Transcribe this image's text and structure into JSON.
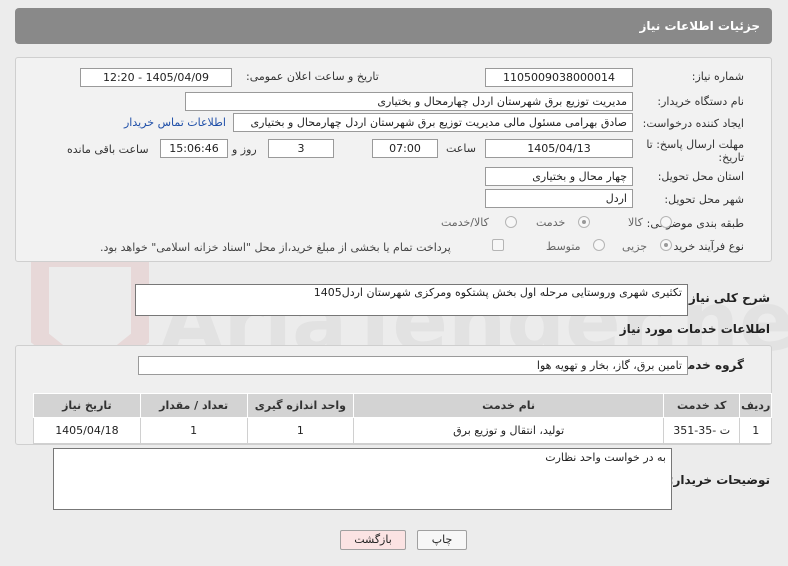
{
  "header": {
    "title": "جزئیات اطلاعات نیاز"
  },
  "form": {
    "need_number_label": "شماره نیاز:",
    "need_number": "1105009038000014",
    "announce_label": "تاریخ و ساعت اعلان عمومی:",
    "announce_value": "1405/04/09 - 12:20",
    "buyer_org_label": "نام دستگاه خریدار:",
    "buyer_org": "مدیریت توزیع برق شهرستان اردل چهارمحال و بختیاری",
    "creator_label": "ایجاد کننده درخواست:",
    "creator": "صادق بهرامی مسئول مالی مدیریت توزیع برق شهرستان اردل چهارمحال و بختیاری",
    "contact_link": "اطلاعات تماس خریدار",
    "deadline_label": "مهلت ارسال پاسخ: تا تاریخ:",
    "deadline_date": "1405/04/13",
    "time_label": "ساعت",
    "deadline_time": "07:00",
    "days_value": "3",
    "days_label": "روز و",
    "remaining_time": "15:06:46",
    "remaining_label": "ساعت باقی مانده",
    "province_label": "استان محل تحویل:",
    "province": "چهار محال و بختیاری",
    "city_label": "شهر محل تحویل:",
    "city": "اردل",
    "category_label": "طبقه بندی موضوعی:",
    "category_options": [
      "کالا",
      "خدمت",
      "کالا/خدمت"
    ],
    "process_label": "نوع فرآیند خرید :",
    "process_options": [
      "جزیی",
      "متوسط"
    ],
    "payment_note": "پرداخت تمام یا بخشی از مبلغ خرید،از محل \"اسناد خزانه اسلامی\" خواهد بود."
  },
  "summary": {
    "label": "شرح کلی نیاز:",
    "text": "تکثیری شهری وروستایی مرحله اول بخش پشتکوه ومرکزی شهرستان اردل1405"
  },
  "services": {
    "section_title": "اطلاعات خدمات مورد نیاز",
    "group_label": "گروه خدمت:",
    "group_value": "تامین برق، گاز، بخار و تهویه هوا",
    "columns": [
      "ردیف",
      "کد خدمت",
      "نام خدمت",
      "واحد اندازه گیری",
      "تعداد / مقدار",
      "تاریخ نیاز"
    ],
    "rows": [
      [
        "1",
        "ت -35-351",
        "تولید، انتقال و توزیع برق",
        "1",
        "1",
        "1405/04/18"
      ]
    ]
  },
  "buyer_notes": {
    "label": "توضیحات خریدار:",
    "text": "به در خواست واحد نظارت"
  },
  "buttons": {
    "print": "چاپ",
    "back": "بازگشت"
  },
  "colors": {
    "header_bg": "#898989",
    "link": "#1f4fa8",
    "back_btn": "#fbe3e3"
  }
}
